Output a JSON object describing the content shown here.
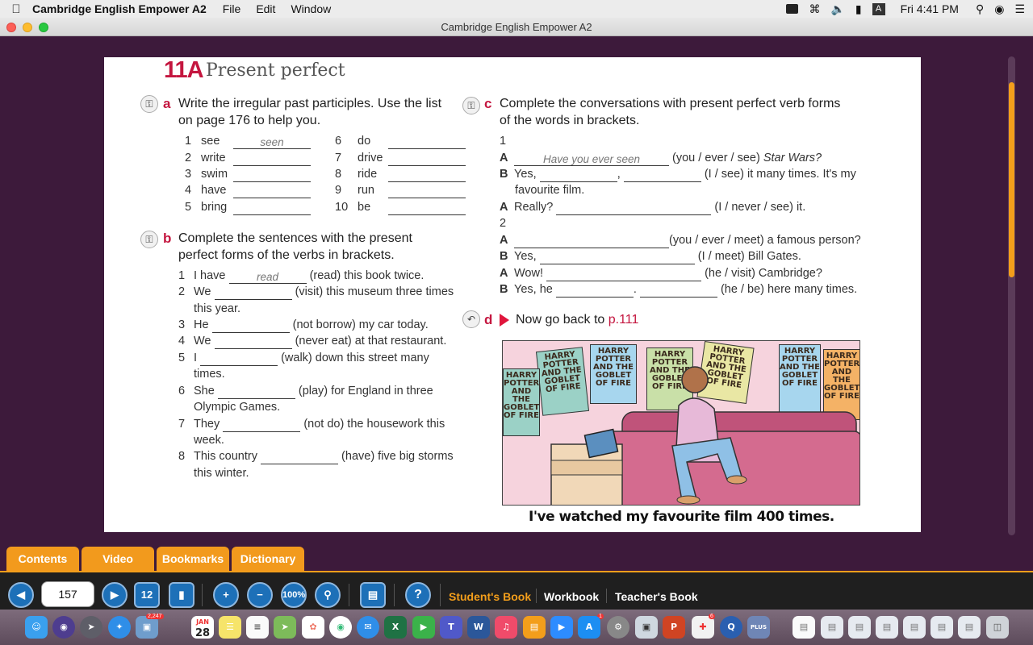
{
  "menubar": {
    "app_name": "Cambridge English Empower A2",
    "menus": [
      "File",
      "Edit",
      "Window"
    ],
    "input_indicator": "A",
    "clock": "Fri 4:41 PM"
  },
  "window": {
    "title": "Cambridge English Empower A2"
  },
  "page": {
    "unit_number": "11A",
    "unit_title": "Present perfect",
    "exercise_a": {
      "letter": "a",
      "instruction_1": "Write the irregular past participles. Use the list",
      "instruction_2": "on page 176 to help you.",
      "items": [
        {
          "num": "1",
          "verb": "see",
          "answer": "seen"
        },
        {
          "num": "2",
          "verb": "write",
          "answer": ""
        },
        {
          "num": "3",
          "verb": "swim",
          "answer": ""
        },
        {
          "num": "4",
          "verb": "have",
          "answer": ""
        },
        {
          "num": "5",
          "verb": "bring",
          "answer": ""
        },
        {
          "num": "6",
          "verb": "do",
          "answer": ""
        },
        {
          "num": "7",
          "verb": "drive",
          "answer": ""
        },
        {
          "num": "8",
          "verb": "ride",
          "answer": ""
        },
        {
          "num": "9",
          "verb": "run",
          "answer": ""
        },
        {
          "num": "10",
          "verb": "be",
          "answer": ""
        }
      ]
    },
    "exercise_b": {
      "letter": "b",
      "instruction_1": "Complete the sentences with the present",
      "instruction_2": "perfect forms of the verbs in brackets.",
      "items": [
        {
          "num": "1",
          "pre": "I have",
          "answer": "read",
          "post": "(read) this book twice."
        },
        {
          "num": "2",
          "pre": "We",
          "answer": "",
          "post": "(visit) this museum three times",
          "cont": "this year."
        },
        {
          "num": "3",
          "pre": "He",
          "answer": "",
          "post": "(not borrow) my car today."
        },
        {
          "num": "4",
          "pre": "We",
          "answer": "",
          "post": "(never eat) at that restaurant."
        },
        {
          "num": "5",
          "pre": "I",
          "answer": "",
          "post": "(walk) down this street many",
          "cont": "times."
        },
        {
          "num": "6",
          "pre": "She",
          "answer": "",
          "post": "(play) for England in three",
          "cont": "Olympic Games."
        },
        {
          "num": "7",
          "pre": "They",
          "answer": "",
          "post": "(not do) the housework this",
          "cont": "week."
        },
        {
          "num": "8",
          "pre": "This country",
          "answer": "",
          "post": "(have) five big storms",
          "cont": "this winter."
        }
      ]
    },
    "exercise_c": {
      "letter": "c",
      "instruction_1": "Complete the conversations with present perfect verb forms",
      "instruction_2": "of the words in brackets.",
      "conv1_num": "1",
      "conv1": [
        {
          "speaker": "A",
          "answer": "Have you ever seen",
          "text": "(you / ever / see)",
          "film": "Star Wars?"
        },
        {
          "speaker": "B",
          "pre": "Yes,",
          "text": "(I / see) it many times. It's my",
          "cont": "favourite film."
        },
        {
          "speaker": "A",
          "pre": "Really?",
          "text": "(I / never / see) it."
        }
      ],
      "conv2_num": "2",
      "conv2": [
        {
          "speaker": "A",
          "text": "(you / ever / meet) a famous person?"
        },
        {
          "speaker": "B",
          "pre": "Yes,",
          "text": "(I / meet) Bill Gates."
        },
        {
          "speaker": "A",
          "pre": "Wow!",
          "text": "(he / visit) Cambridge?"
        },
        {
          "speaker": "B",
          "pre": "Yes, he",
          "text": "(he / be) here many times."
        }
      ]
    },
    "exercise_d": {
      "letter": "d",
      "text": "Now go back to",
      "page_ref": "p.111"
    },
    "illustration": {
      "poster_text": "HARRY POTTER AND THE GOBLET OF FIRE",
      "caption": "I've watched my favourite film 400 times."
    }
  },
  "bottom_tabs": [
    "Contents",
    "Video",
    "Bookmarks",
    "Dictionary"
  ],
  "toolbar": {
    "page_number": "157",
    "two_page_label": "12",
    "zoom_100_label": "100%",
    "help_label": "?",
    "books": [
      "Student's Book",
      "Workbook",
      "Teacher's Book"
    ]
  },
  "dock": {
    "calendar_month": "JAN",
    "calendar_day": "28",
    "badges": {
      "photos": "2,247",
      "appstore": "1",
      "plus": "6"
    }
  }
}
